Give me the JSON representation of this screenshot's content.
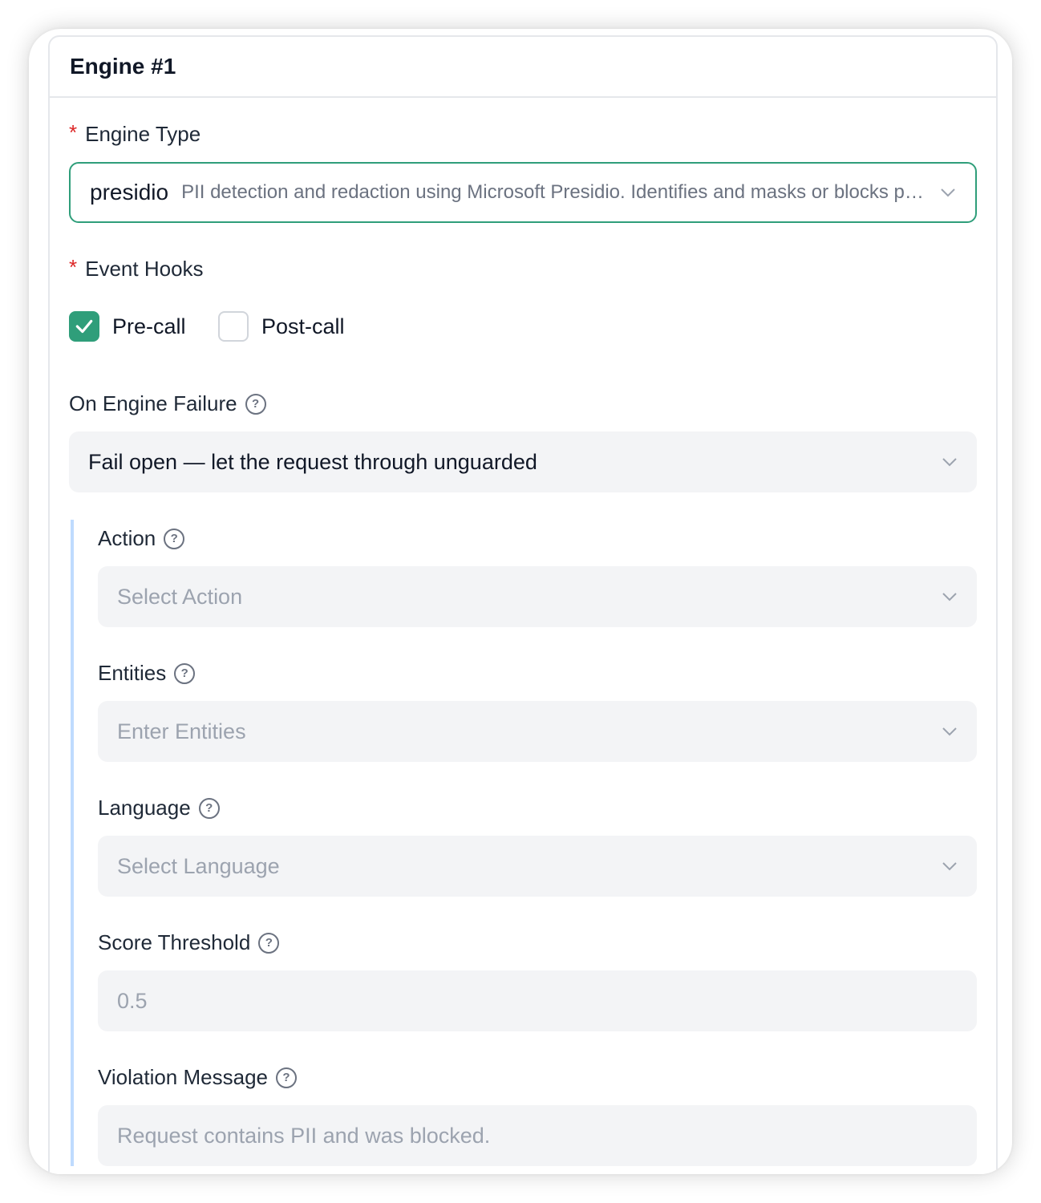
{
  "engine": {
    "title": "Engine #1",
    "engine_type": {
      "label": "Engine Type",
      "required_mark": "*",
      "value_name": "presidio",
      "value_description": "PII detection and redaction using Microsoft Presidio. Identifies and masks or blocks personal information."
    },
    "event_hooks": {
      "label": "Event Hooks",
      "required_mark": "*",
      "options": [
        {
          "label": "Pre-call",
          "checked": true
        },
        {
          "label": "Post-call",
          "checked": false
        }
      ]
    },
    "on_failure": {
      "label": "On Engine Failure",
      "value": "Fail open — let the request through unguarded"
    },
    "settings": {
      "action": {
        "label": "Action",
        "placeholder": "Select Action"
      },
      "entities": {
        "label": "Entities",
        "placeholder": "Enter Entities"
      },
      "language": {
        "label": "Language",
        "placeholder": "Select Language"
      },
      "score_threshold": {
        "label": "Score Threshold",
        "placeholder": "0.5"
      },
      "violation_message": {
        "label": "Violation Message",
        "placeholder": "Request contains PII and was blocked."
      }
    }
  },
  "colors": {
    "accent": "#2f9e7a",
    "required": "#dc2626",
    "field_bg": "#f3f4f6",
    "nested_bar": "#bfdbfe"
  },
  "icons": {
    "help": "question-circle-icon",
    "chevron": "chevron-down-icon",
    "check": "check-icon"
  }
}
